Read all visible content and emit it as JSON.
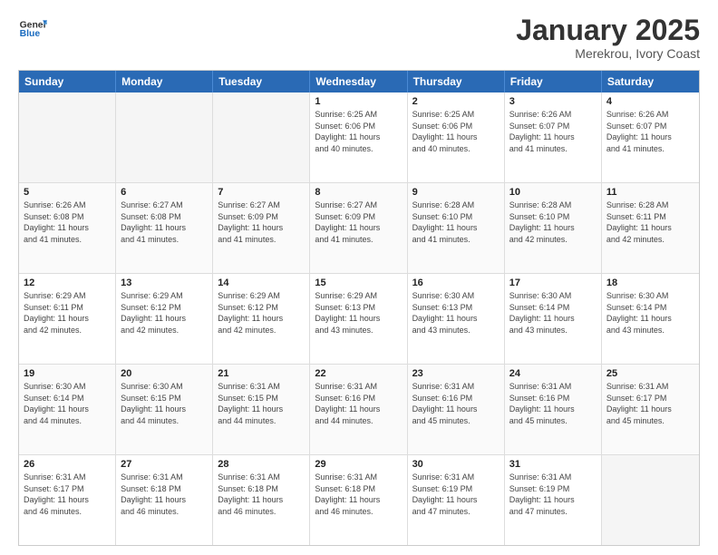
{
  "header": {
    "logo_general": "General",
    "logo_blue": "Blue",
    "month_title": "January 2025",
    "location": "Merekrou, Ivory Coast"
  },
  "weekdays": [
    "Sunday",
    "Monday",
    "Tuesday",
    "Wednesday",
    "Thursday",
    "Friday",
    "Saturday"
  ],
  "weeks": [
    [
      {
        "day": "",
        "empty": true
      },
      {
        "day": "",
        "empty": true
      },
      {
        "day": "",
        "empty": true
      },
      {
        "day": "1",
        "sunrise": "Sunrise: 6:25 AM",
        "sunset": "Sunset: 6:06 PM",
        "daylight": "Daylight: 11 hours and 40 minutes."
      },
      {
        "day": "2",
        "sunrise": "Sunrise: 6:25 AM",
        "sunset": "Sunset: 6:06 PM",
        "daylight": "Daylight: 11 hours and 40 minutes."
      },
      {
        "day": "3",
        "sunrise": "Sunrise: 6:26 AM",
        "sunset": "Sunset: 6:07 PM",
        "daylight": "Daylight: 11 hours and 41 minutes."
      },
      {
        "day": "4",
        "sunrise": "Sunrise: 6:26 AM",
        "sunset": "Sunset: 6:07 PM",
        "daylight": "Daylight: 11 hours and 41 minutes."
      }
    ],
    [
      {
        "day": "5",
        "sunrise": "Sunrise: 6:26 AM",
        "sunset": "Sunset: 6:08 PM",
        "daylight": "Daylight: 11 hours and 41 minutes."
      },
      {
        "day": "6",
        "sunrise": "Sunrise: 6:27 AM",
        "sunset": "Sunset: 6:08 PM",
        "daylight": "Daylight: 11 hours and 41 minutes."
      },
      {
        "day": "7",
        "sunrise": "Sunrise: 6:27 AM",
        "sunset": "Sunset: 6:09 PM",
        "daylight": "Daylight: 11 hours and 41 minutes."
      },
      {
        "day": "8",
        "sunrise": "Sunrise: 6:27 AM",
        "sunset": "Sunset: 6:09 PM",
        "daylight": "Daylight: 11 hours and 41 minutes."
      },
      {
        "day": "9",
        "sunrise": "Sunrise: 6:28 AM",
        "sunset": "Sunset: 6:10 PM",
        "daylight": "Daylight: 11 hours and 41 minutes."
      },
      {
        "day": "10",
        "sunrise": "Sunrise: 6:28 AM",
        "sunset": "Sunset: 6:10 PM",
        "daylight": "Daylight: 11 hours and 42 minutes."
      },
      {
        "day": "11",
        "sunrise": "Sunrise: 6:28 AM",
        "sunset": "Sunset: 6:11 PM",
        "daylight": "Daylight: 11 hours and 42 minutes."
      }
    ],
    [
      {
        "day": "12",
        "sunrise": "Sunrise: 6:29 AM",
        "sunset": "Sunset: 6:11 PM",
        "daylight": "Daylight: 11 hours and 42 minutes."
      },
      {
        "day": "13",
        "sunrise": "Sunrise: 6:29 AM",
        "sunset": "Sunset: 6:12 PM",
        "daylight": "Daylight: 11 hours and 42 minutes."
      },
      {
        "day": "14",
        "sunrise": "Sunrise: 6:29 AM",
        "sunset": "Sunset: 6:12 PM",
        "daylight": "Daylight: 11 hours and 42 minutes."
      },
      {
        "day": "15",
        "sunrise": "Sunrise: 6:29 AM",
        "sunset": "Sunset: 6:13 PM",
        "daylight": "Daylight: 11 hours and 43 minutes."
      },
      {
        "day": "16",
        "sunrise": "Sunrise: 6:30 AM",
        "sunset": "Sunset: 6:13 PM",
        "daylight": "Daylight: 11 hours and 43 minutes."
      },
      {
        "day": "17",
        "sunrise": "Sunrise: 6:30 AM",
        "sunset": "Sunset: 6:14 PM",
        "daylight": "Daylight: 11 hours and 43 minutes."
      },
      {
        "day": "18",
        "sunrise": "Sunrise: 6:30 AM",
        "sunset": "Sunset: 6:14 PM",
        "daylight": "Daylight: 11 hours and 43 minutes."
      }
    ],
    [
      {
        "day": "19",
        "sunrise": "Sunrise: 6:30 AM",
        "sunset": "Sunset: 6:14 PM",
        "daylight": "Daylight: 11 hours and 44 minutes."
      },
      {
        "day": "20",
        "sunrise": "Sunrise: 6:30 AM",
        "sunset": "Sunset: 6:15 PM",
        "daylight": "Daylight: 11 hours and 44 minutes."
      },
      {
        "day": "21",
        "sunrise": "Sunrise: 6:31 AM",
        "sunset": "Sunset: 6:15 PM",
        "daylight": "Daylight: 11 hours and 44 minutes."
      },
      {
        "day": "22",
        "sunrise": "Sunrise: 6:31 AM",
        "sunset": "Sunset: 6:16 PM",
        "daylight": "Daylight: 11 hours and 44 minutes."
      },
      {
        "day": "23",
        "sunrise": "Sunrise: 6:31 AM",
        "sunset": "Sunset: 6:16 PM",
        "daylight": "Daylight: 11 hours and 45 minutes."
      },
      {
        "day": "24",
        "sunrise": "Sunrise: 6:31 AM",
        "sunset": "Sunset: 6:16 PM",
        "daylight": "Daylight: 11 hours and 45 minutes."
      },
      {
        "day": "25",
        "sunrise": "Sunrise: 6:31 AM",
        "sunset": "Sunset: 6:17 PM",
        "daylight": "Daylight: 11 hours and 45 minutes."
      }
    ],
    [
      {
        "day": "26",
        "sunrise": "Sunrise: 6:31 AM",
        "sunset": "Sunset: 6:17 PM",
        "daylight": "Daylight: 11 hours and 46 minutes."
      },
      {
        "day": "27",
        "sunrise": "Sunrise: 6:31 AM",
        "sunset": "Sunset: 6:18 PM",
        "daylight": "Daylight: 11 hours and 46 minutes."
      },
      {
        "day": "28",
        "sunrise": "Sunrise: 6:31 AM",
        "sunset": "Sunset: 6:18 PM",
        "daylight": "Daylight: 11 hours and 46 minutes."
      },
      {
        "day": "29",
        "sunrise": "Sunrise: 6:31 AM",
        "sunset": "Sunset: 6:18 PM",
        "daylight": "Daylight: 11 hours and 46 minutes."
      },
      {
        "day": "30",
        "sunrise": "Sunrise: 6:31 AM",
        "sunset": "Sunset: 6:19 PM",
        "daylight": "Daylight: 11 hours and 47 minutes."
      },
      {
        "day": "31",
        "sunrise": "Sunrise: 6:31 AM",
        "sunset": "Sunset: 6:19 PM",
        "daylight": "Daylight: 11 hours and 47 minutes."
      },
      {
        "day": "",
        "empty": true
      }
    ]
  ]
}
